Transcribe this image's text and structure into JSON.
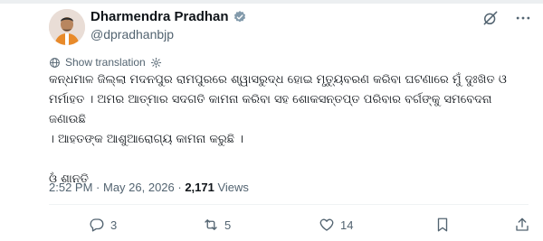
{
  "author": {
    "name": "Dharmendra Pradhan",
    "handle": "@dpradhanbjp"
  },
  "translate_label": "Show translation",
  "tweet": {
    "paragraph_1": "କନ୍ଧମାଳ ଜିଲ୍ଲା ମଦନପୁର ରାମପୁରରେ ଶ୍ୱାସରୁଦ୍ଧ ହୋଇ ମୃତ୍ୟୁବରଣ କରିବା ଘଟଣାରେ ମୁଁ ଦୁଃଖିତ ଓ\nମର୍ମାହତ । ଅମର ଆତ୍ମାର ସଦଗତି କାମନା କରିବା ସହ ଶୋକସନ୍ତପ୍ତ ପରିବାର ବର୍ଗଙ୍କୁ ସମବେଦନା ଜଣାଉଛି\n। ଆହତଙ୍କ ଆଶୁଆରୋଗ୍ୟ କାମନା କରୁଛି ।",
    "paragraph_2": "ଓଁ ଶାନ୍ତି"
  },
  "meta": {
    "time": "2:52 PM",
    "sep": " · ",
    "date": "May 26, 2026",
    "views_count": "2,171",
    "views_label": " Views"
  },
  "actions": {
    "replies": "3",
    "reposts": "5",
    "likes": "14"
  },
  "colors": {
    "text": "#0f1419",
    "muted": "#536471",
    "verified": "#829aab",
    "divider": "#eff3f4"
  }
}
